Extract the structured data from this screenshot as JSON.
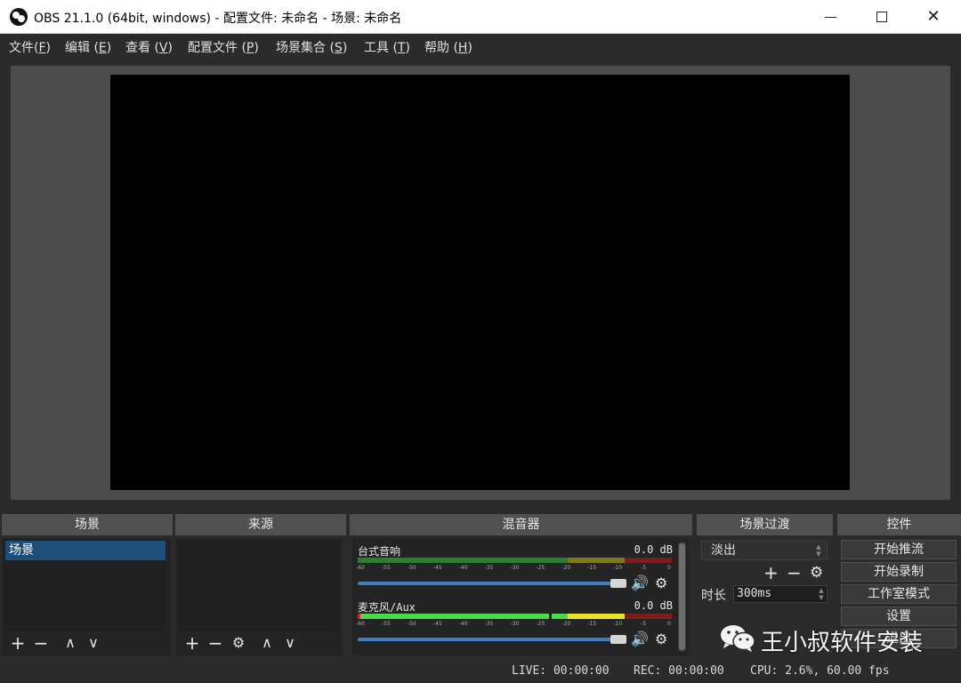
{
  "window": {
    "title": "OBS 21.1.0 (64bit, windows) - 配置文件: 未命名 - 场景: 未命名",
    "minimize": "—",
    "close": "✕"
  },
  "menu": [
    {
      "label": "文件(",
      "key": "F",
      "end": ")"
    },
    {
      "label": "编辑 (",
      "key": "E",
      "end": ")"
    },
    {
      "label": "查看 (",
      "key": "V",
      "end": ")"
    },
    {
      "label": "配置文件 (",
      "key": "P",
      "end": ")"
    },
    {
      "label": "场景集合 (",
      "key": "S",
      "end": ")"
    },
    {
      "label": "工具 (",
      "key": "T",
      "end": ")"
    },
    {
      "label": "帮助 (",
      "key": "H",
      "end": ")"
    }
  ],
  "docks": {
    "scenes": "场景",
    "sources": "来源",
    "mixer": "混音器",
    "transitions": "场景过渡",
    "controls": "控件"
  },
  "scenes": {
    "items": [
      "场景"
    ]
  },
  "tool_icons": {
    "add": "+",
    "remove": "−",
    "up": "∧",
    "down": "∨",
    "gear": "⚙",
    "speaker": "🔊"
  },
  "mixer": {
    "tracks": [
      {
        "name": "台式音响",
        "db": "0.0 dB",
        "level": 0.0
      },
      {
        "name": "麦克风/Aux",
        "db": "0.0 dB",
        "level": 0.62
      }
    ],
    "ticks": [
      "-60",
      "-55",
      "-50",
      "-45",
      "-40",
      "-35",
      "-30",
      "-25",
      "-20",
      "-15",
      "-10",
      "-5",
      "0"
    ]
  },
  "transitions": {
    "selected": "淡出",
    "duration_label": "时长",
    "duration_value": "300ms"
  },
  "controls": {
    "buttons": [
      "开始推流",
      "开始录制",
      "工作室模式",
      "设置",
      "退出"
    ]
  },
  "status": {
    "live": "LIVE: 00:00:00",
    "rec": "REC: 00:00:00",
    "cpu": "CPU: 2.6%, 60.00 fps"
  },
  "watermark": {
    "text": "王小叔软件安装"
  },
  "colors": {
    "accent": "#1d4e7a",
    "panel": "#242424",
    "header": "#505050"
  }
}
